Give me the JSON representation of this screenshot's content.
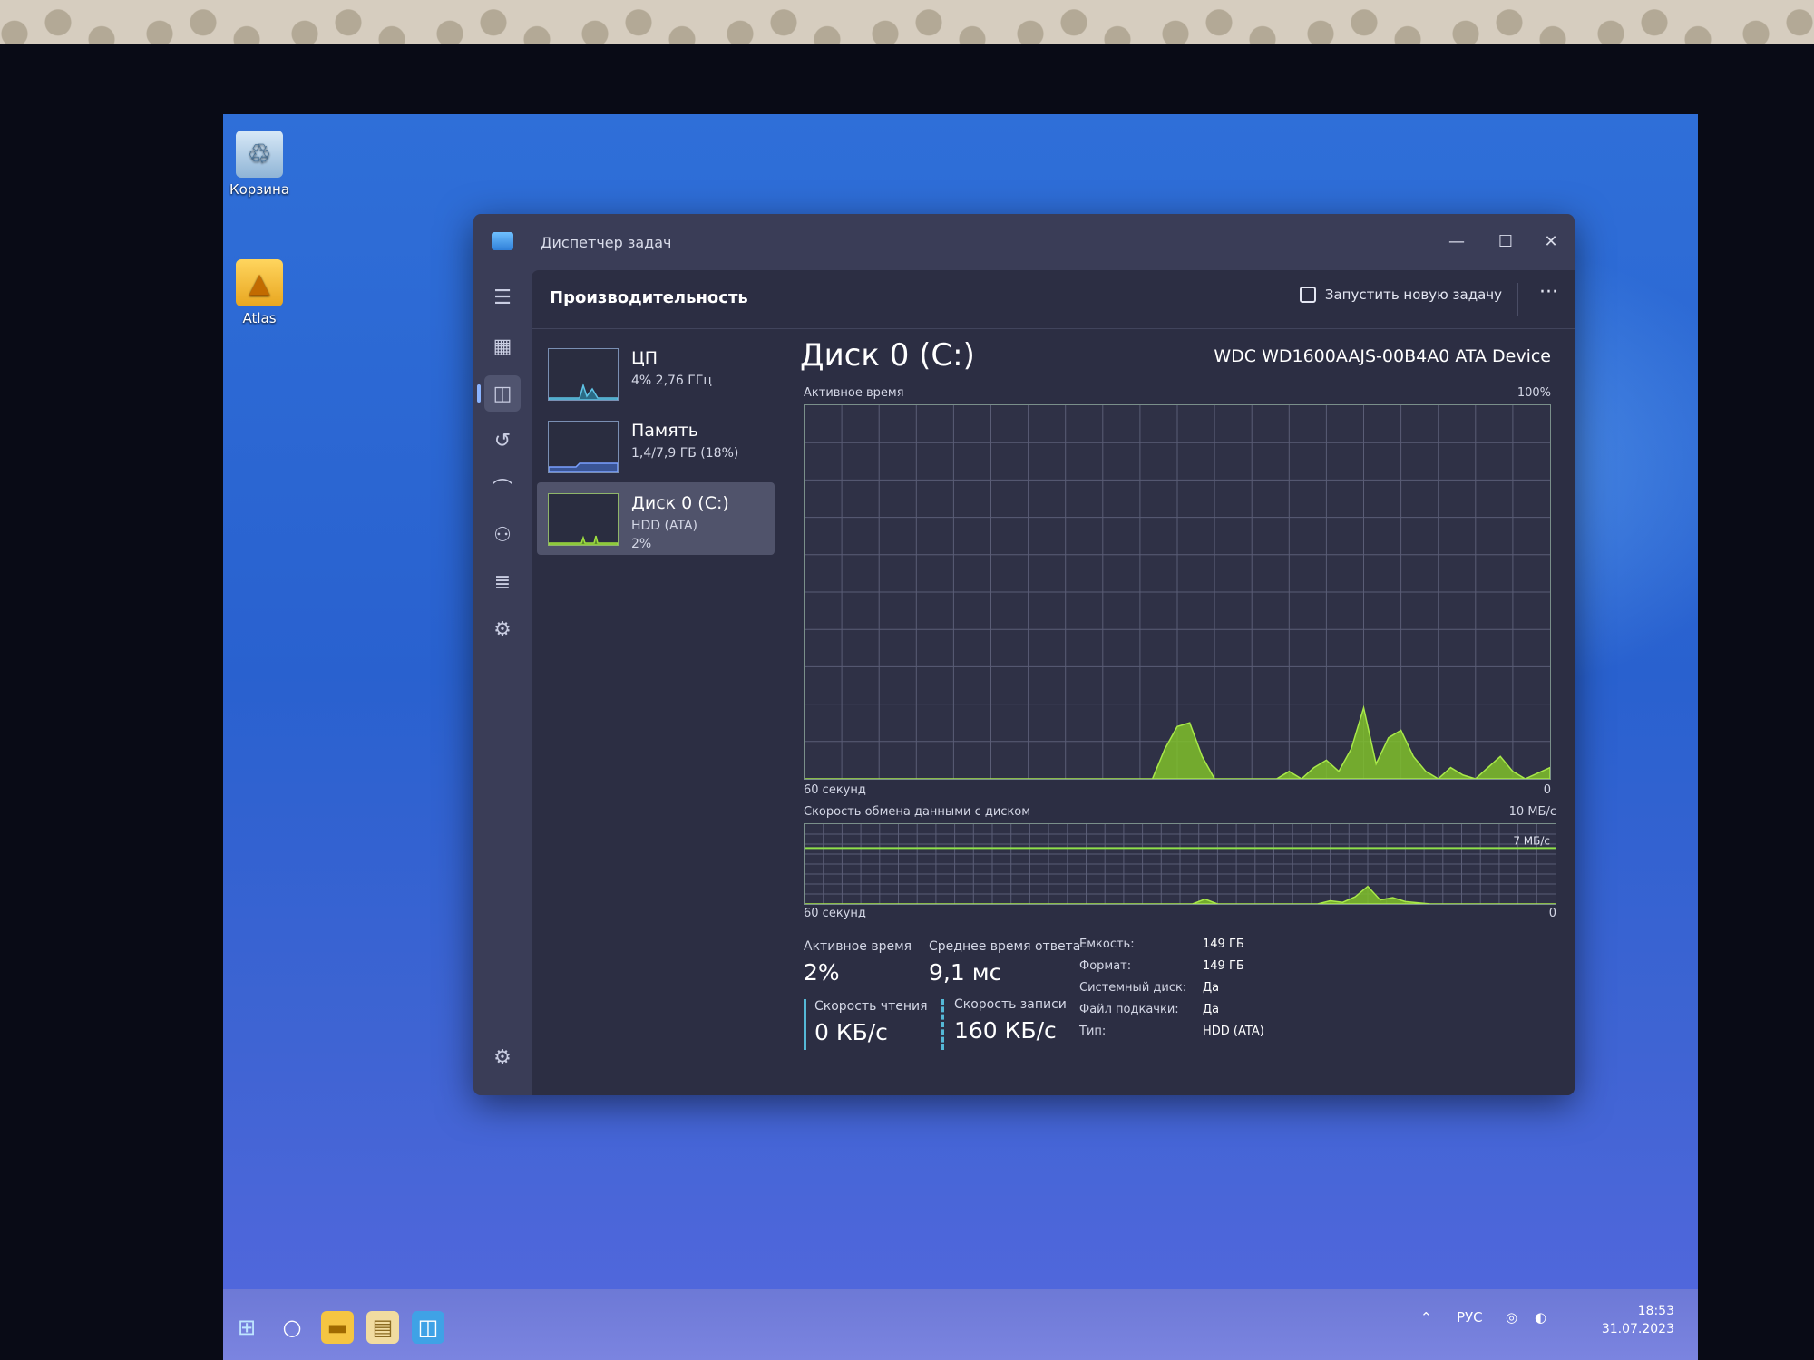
{
  "desktop": {
    "icons": [
      {
        "label": "Корзина"
      },
      {
        "label": "Atlas"
      }
    ]
  },
  "window": {
    "title": "Диспетчер задач"
  },
  "header": {
    "title": "Производительность",
    "run_task_label": "Запустить новую задачу",
    "more_label": "···"
  },
  "devices": [
    {
      "name": "ЦП",
      "line1": "4% 2,76 ГГц",
      "line2": ""
    },
    {
      "name": "Память",
      "line1": "1,4/7,9 ГБ (18%)",
      "line2": ""
    },
    {
      "name": "Диск 0 (C:)",
      "line1": "HDD (ATA)",
      "line2": "2%"
    }
  ],
  "disk": {
    "title": "Диск 0 (C:)",
    "model": "WDC WD1600AAJS-00B4A0 ATA Device",
    "active_time_label": "Активное время",
    "active_time_max": "100%",
    "active_time_xlabel": "60 секунд",
    "active_time_min": "0",
    "transfer_label": "Скорость обмена данными с диском",
    "transfer_max": "10 МБ/с",
    "transfer_marker": "7 МБ/с",
    "transfer_xlabel": "60 секунд",
    "transfer_min": "0"
  },
  "stats": {
    "active_time": {
      "label": "Активное время",
      "value": "2%"
    },
    "avg_response": {
      "label": "Среднее время ответа",
      "value": "9,1 мс"
    },
    "read_speed": {
      "label": "Скорость чтения",
      "value": "0 КБ/с"
    },
    "write_speed": {
      "label": "Скорость записи",
      "value": "160 КБ/с"
    }
  },
  "properties": [
    {
      "label": "Емкость:",
      "value": "149 ГБ"
    },
    {
      "label": "Формат:",
      "value": "149 ГБ"
    },
    {
      "label": "Системный диск:",
      "value": "Да"
    },
    {
      "label": "Файл подкачки:",
      "value": "Да"
    },
    {
      "label": "Тип:",
      "value": "HDD (ATA)"
    }
  ],
  "taskbar": {
    "lang": "РУС",
    "time": "18:53",
    "date": "31.07.2023"
  },
  "chart_data": [
    {
      "type": "area",
      "title": "Активное время",
      "ylim": [
        0,
        100
      ],
      "x": [
        0,
        2,
        4,
        6,
        8,
        10,
        12,
        14,
        16,
        18,
        20,
        22,
        24,
        26,
        28,
        30,
        32,
        34,
        36,
        38,
        40,
        42,
        44,
        46,
        48,
        50,
        52,
        54,
        56,
        58,
        60
      ],
      "values": [
        0,
        0,
        0,
        0,
        0,
        0,
        0,
        0,
        0,
        0,
        0,
        0,
        0,
        0,
        0,
        0,
        0,
        0,
        0,
        0,
        0,
        0,
        0,
        0,
        0,
        0,
        0,
        0,
        0,
        0,
        0,
        0,
        0,
        0,
        0,
        0,
        0,
        0,
        0,
        0,
        0,
        0,
        0,
        0,
        0,
        0,
        0,
        0,
        0,
        0,
        0,
        0,
        0,
        0,
        0,
        0,
        0,
        0,
        0,
        0,
        0
      ],
      "series": [
        {
          "values": [
            0,
            0,
            0,
            0,
            0,
            0,
            0,
            0,
            0,
            0,
            0,
            0,
            0,
            0,
            0,
            0,
            0,
            0,
            0,
            0,
            0,
            0,
            0,
            0,
            0,
            0,
            0,
            0,
            0,
            0,
            0,
            0,
            0,
            0,
            0,
            0,
            0,
            0,
            0,
            0,
            0,
            0,
            0,
            0,
            0,
            0,
            0,
            0,
            0,
            0,
            0,
            0,
            0,
            0,
            0,
            0,
            0,
            0,
            0,
            0,
            0
          ]
        }
      ],
      "points": [
        [
          0,
          0
        ],
        [
          28,
          0
        ],
        [
          29,
          8
        ],
        [
          30,
          14
        ],
        [
          31,
          15
        ],
        [
          32,
          6
        ],
        [
          33,
          0
        ],
        [
          38,
          0
        ],
        [
          39,
          2
        ],
        [
          40,
          0
        ],
        [
          41,
          3
        ],
        [
          42,
          5
        ],
        [
          43,
          2
        ],
        [
          44,
          8
        ],
        [
          45,
          19
        ],
        [
          46,
          4
        ],
        [
          47,
          11
        ],
        [
          48,
          13
        ],
        [
          49,
          6
        ],
        [
          50,
          2
        ],
        [
          51,
          0
        ],
        [
          52,
          3
        ],
        [
          53,
          1
        ],
        [
          54,
          0
        ],
        [
          55,
          3
        ],
        [
          56,
          6
        ],
        [
          57,
          2
        ],
        [
          58,
          0
        ],
        [
          60,
          3
        ]
      ]
    },
    {
      "type": "area",
      "title": "Скорость обмена данными с диском",
      "ylim": [
        0,
        10
      ],
      "points": [
        [
          0,
          0
        ],
        [
          31,
          0
        ],
        [
          32,
          0.6
        ],
        [
          33,
          0
        ],
        [
          41,
          0
        ],
        [
          42,
          0.4
        ],
        [
          43,
          0.2
        ],
        [
          44,
          0.9
        ],
        [
          45,
          2.2
        ],
        [
          46,
          0.5
        ],
        [
          47,
          0.8
        ],
        [
          48,
          0.3
        ],
        [
          50,
          0
        ],
        [
          60,
          0
        ]
      ],
      "marker": 7
    }
  ]
}
